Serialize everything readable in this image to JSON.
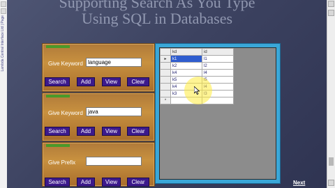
{
  "slide": {
    "title_line1": "Supporting Search As You Type",
    "title_line2": "Using SQL in Databases"
  },
  "toolbar": {
    "side_text": "Lambda Central Interface Ltd | Page"
  },
  "panels": [
    {
      "label": "Give Keyword",
      "input_value": "language",
      "buttons": [
        "Search",
        "Add",
        "View",
        "Clear"
      ]
    },
    {
      "label": "Give Keyword",
      "input_value": "java",
      "buttons": [
        "Search",
        "Add",
        "View",
        "Clear"
      ]
    },
    {
      "label": "Give Prefix",
      "input_value": "",
      "buttons": [
        "Search",
        "Add",
        "View",
        "Clear"
      ]
    }
  ],
  "grid": {
    "columns": [
      "kd",
      "id"
    ],
    "rows": [
      [
        "k1",
        "l1"
      ],
      [
        "k2",
        "l2"
      ],
      [
        "k4",
        "l4"
      ],
      [
        "k5",
        "l5"
      ],
      [
        "k4",
        "l4"
      ],
      [
        "k3",
        "l3"
      ]
    ],
    "selected_row": 0
  },
  "nav": {
    "next_label": "Next"
  },
  "colors": {
    "slide_bg": "#3c4260",
    "panel_bg": "#c8913f",
    "button_bg": "#3c1a8c",
    "grid_frame": "#3aa7d8",
    "selection": "#2f5dcf"
  }
}
